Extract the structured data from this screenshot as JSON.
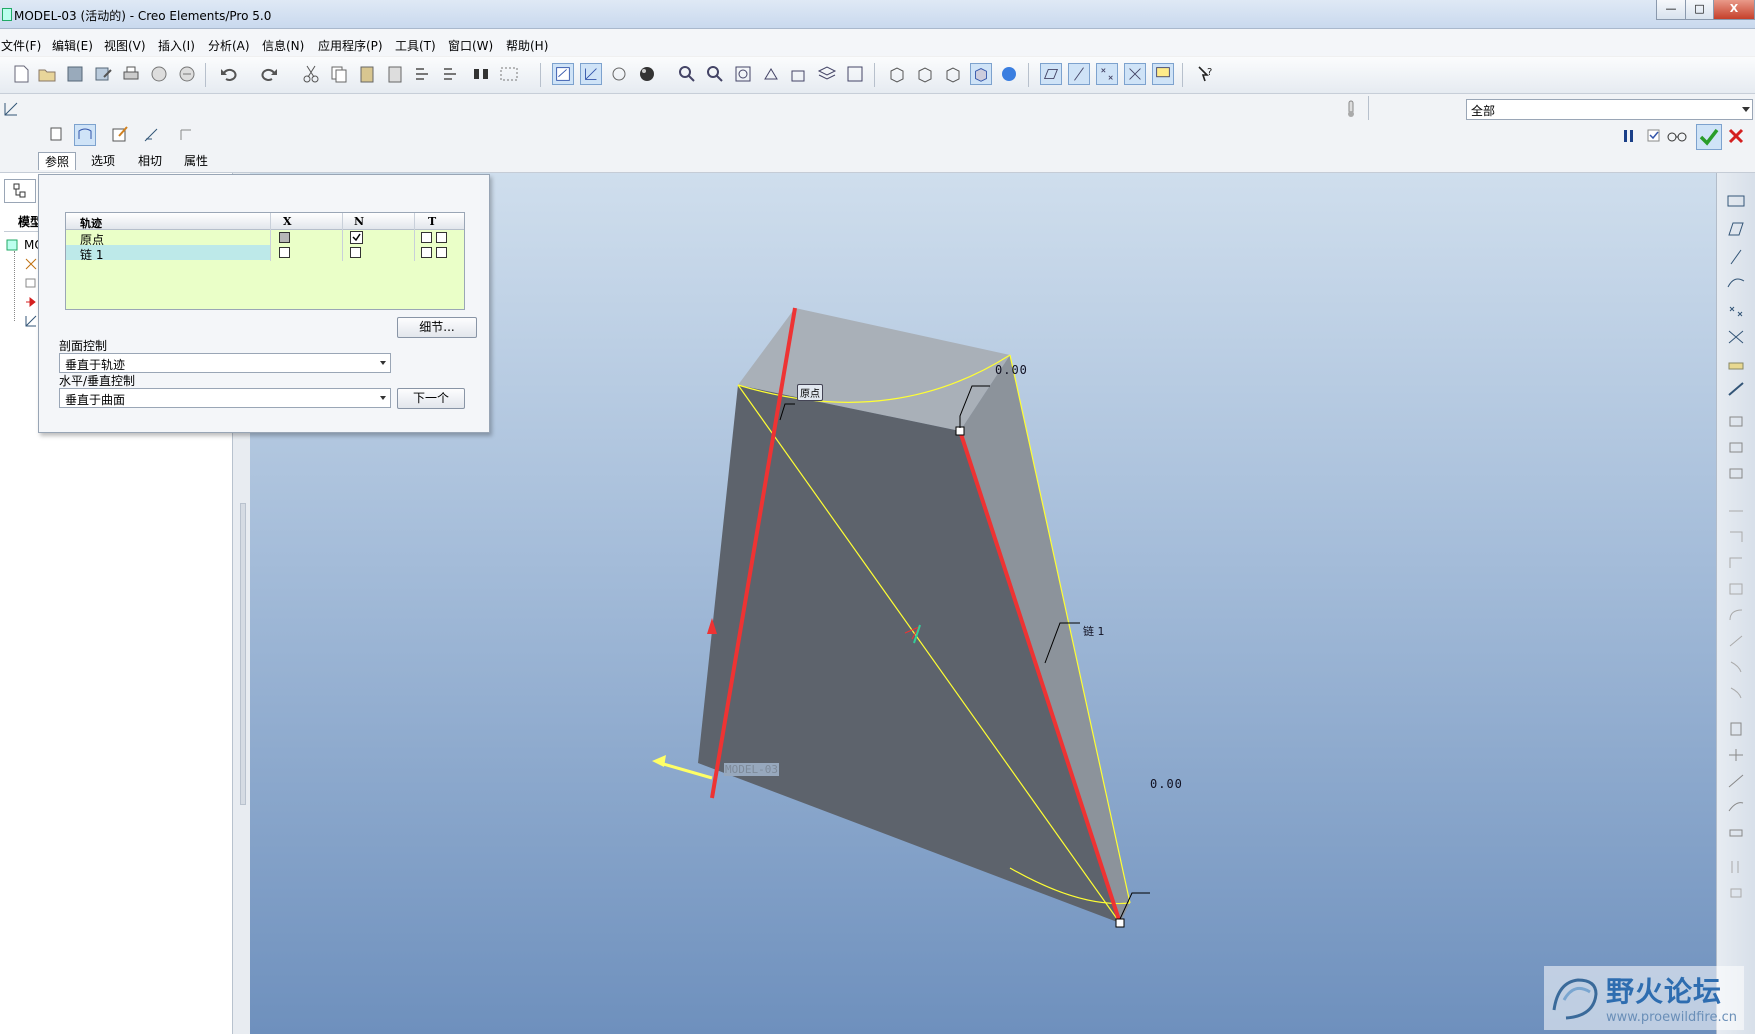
{
  "window": {
    "title": "MODEL-03 (活动的) - Creo Elements/Pro 5.0",
    "minimize_label": "—",
    "restore_label": "□",
    "close_label": "X"
  },
  "menubar": {
    "items": [
      "文件(F)",
      "编辑(E)",
      "视图(V)",
      "插入(I)",
      "分析(A)",
      "信息(N)",
      "应用程序(P)",
      "工具(T)",
      "窗口(W)",
      "帮助(H)"
    ]
  },
  "dashboard": {
    "tabs": [
      "参照",
      "选项",
      "相切",
      "属性"
    ],
    "filter_value": "全部"
  },
  "left_panel": {
    "tab_label": "模型",
    "tree_root": "MO"
  },
  "references": {
    "columns": {
      "name": "轨迹",
      "x": "X",
      "n": "N",
      "t": "T"
    },
    "rows": [
      {
        "name": "原点",
        "x": "gray",
        "n": true,
        "t": [
          false,
          false
        ]
      },
      {
        "name": "链  1",
        "x": false,
        "n": false,
        "t": [
          false,
          false
        ]
      }
    ],
    "details_button": "细节...",
    "section_control_label": "剖面控制",
    "section_control_value": "垂直于轨迹",
    "hv_control_label": "水平/垂直控制",
    "hv_control_value": "垂直于曲面",
    "next_button": "下一个"
  },
  "viewport": {
    "labels": {
      "dim_top": "0.00",
      "origin": "原点",
      "chain": "链  1",
      "dim_bottom": "0.00",
      "model": "MODEL-03"
    }
  },
  "watermark": {
    "title": "野火论坛",
    "url": "www.proewildfire.cn"
  },
  "colors": {
    "trajectory": "#ee3333",
    "edge": "#ffff33",
    "table_bg": "#eaffc8",
    "accept": "#2a9d2a",
    "cancel": "#d42020"
  }
}
